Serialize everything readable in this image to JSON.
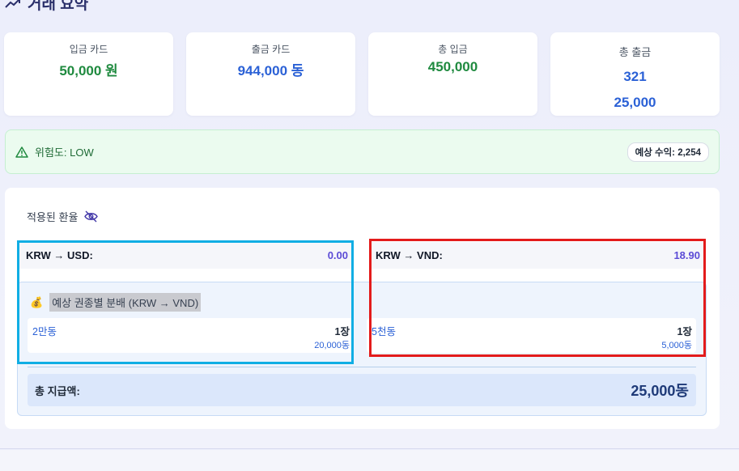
{
  "heading": {
    "title": "거래 요약",
    "icon": "trend-chart-icon"
  },
  "cards": [
    {
      "label": "입금 카드",
      "value": "50,000 원",
      "color": "#1f8a3f"
    },
    {
      "label": "출금 카드",
      "value": "944,000 동",
      "color": "#2b61d6"
    },
    {
      "label": "총 입금",
      "value": "450,000",
      "color": "#1f8a3f"
    },
    {
      "label": "총 출금",
      "value_line1": "321",
      "value_line2": "25,000",
      "color": "#2b61d6"
    }
  ],
  "risk": {
    "text": "위험도: LOW",
    "badge": "예상 수익: 2,254",
    "icon": "warning-triangle-icon"
  },
  "rates": {
    "title": "적용된 환율",
    "toggle_icon": "eye-off-icon",
    "usd": {
      "pair": "KRW → USD:",
      "value": "0.00"
    },
    "vnd": {
      "pair": "KRW → VND:",
      "value": "18.90"
    }
  },
  "distribution": {
    "icon": "money-bag-icon",
    "title": "예상 권종별 분배 (KRW → VND)",
    "notes": [
      {
        "label": "2만동",
        "count": "1장",
        "sum": "20,000동"
      },
      {
        "label": "5천동",
        "count": "1장",
        "sum": "5,000동"
      }
    ],
    "total_label": "총 지급액:",
    "total_value": "25,000동"
  },
  "colors": {
    "green": "#1f8a3f",
    "blue": "#2b61d6",
    "purple": "#5b4bd6",
    "highlight_cyan": "#10aee4",
    "highlight_red": "#e31b1b"
  }
}
